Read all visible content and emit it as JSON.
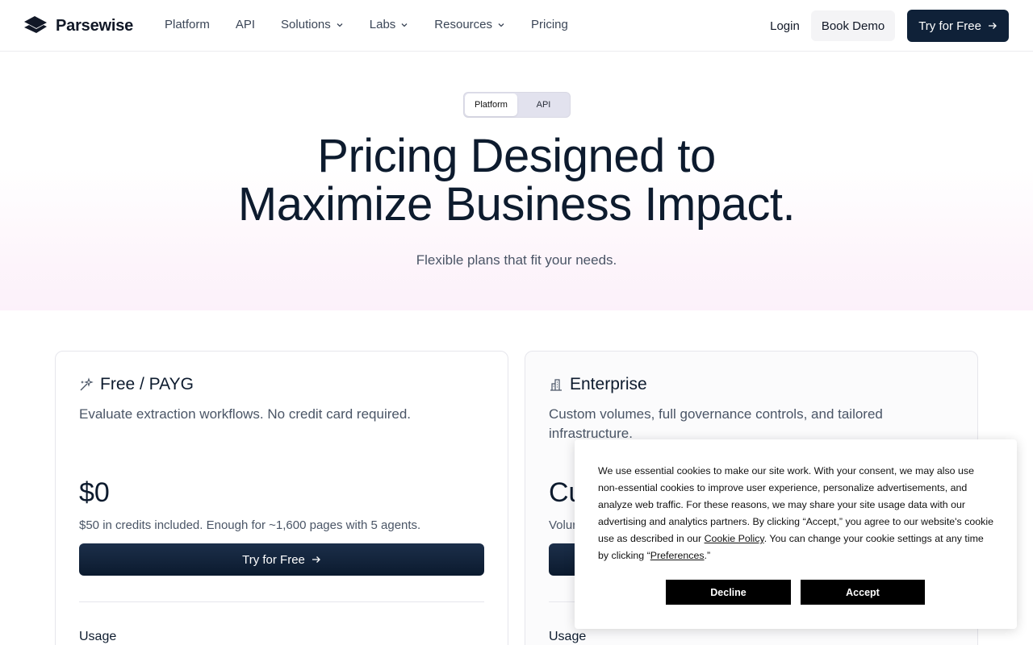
{
  "nav": {
    "logo_text": "Parsewise",
    "links": [
      {
        "label": "Platform",
        "dropdown": false
      },
      {
        "label": "API",
        "dropdown": false
      },
      {
        "label": "Solutions",
        "dropdown": true
      },
      {
        "label": "Labs",
        "dropdown": true
      },
      {
        "label": "Resources",
        "dropdown": true
      },
      {
        "label": "Pricing",
        "dropdown": false
      }
    ],
    "login": "Login",
    "book_demo": "Book Demo",
    "try_free": "Try for Free"
  },
  "hero": {
    "toggle": {
      "active": "Platform",
      "inactive": "API"
    },
    "title_line1": "Pricing Designed to",
    "title_line2": "Maximize Business Impact.",
    "subtitle": "Flexible plans that fit your needs."
  },
  "plans": [
    {
      "icon": "sparkles-icon",
      "name": "Free / PAYG",
      "description": "Evaluate extraction workflows. No credit card required.",
      "price": "$0",
      "note": "$50 in credits included. Enough for ~1,600 pages with 5 agents.",
      "button": "Try for Free",
      "section": "Usage"
    },
    {
      "icon": "building-icon",
      "name": "Enterprise",
      "description": "Custom volumes, full governance controls, and tailored infrastructure.",
      "price": "Cu",
      "note": "Volur",
      "button": "",
      "section": "Usage"
    }
  ],
  "cookie": {
    "text_before_link": "We use essential cookies to make our site work. With your consent, we may also use non-essential cookies to improve user experience, personalize advertisements, and analyze web traffic. For these reasons, we may share your site usage data with our advertising and analytics partners. By clicking “Accept,” you agree to our website's cookie use as described in our ",
    "link1": "Cookie Policy",
    "text_middle": ". You can change your cookie settings at any time by clicking “",
    "link2": "Preferences",
    "text_after": ".”",
    "decline": "Decline",
    "accept": "Accept"
  },
  "colors": {
    "primary_navy": "#0f2138",
    "text_dark": "#0d1b2e",
    "text_muted": "#4a5566",
    "hero_pink": "#fcf1fa"
  }
}
